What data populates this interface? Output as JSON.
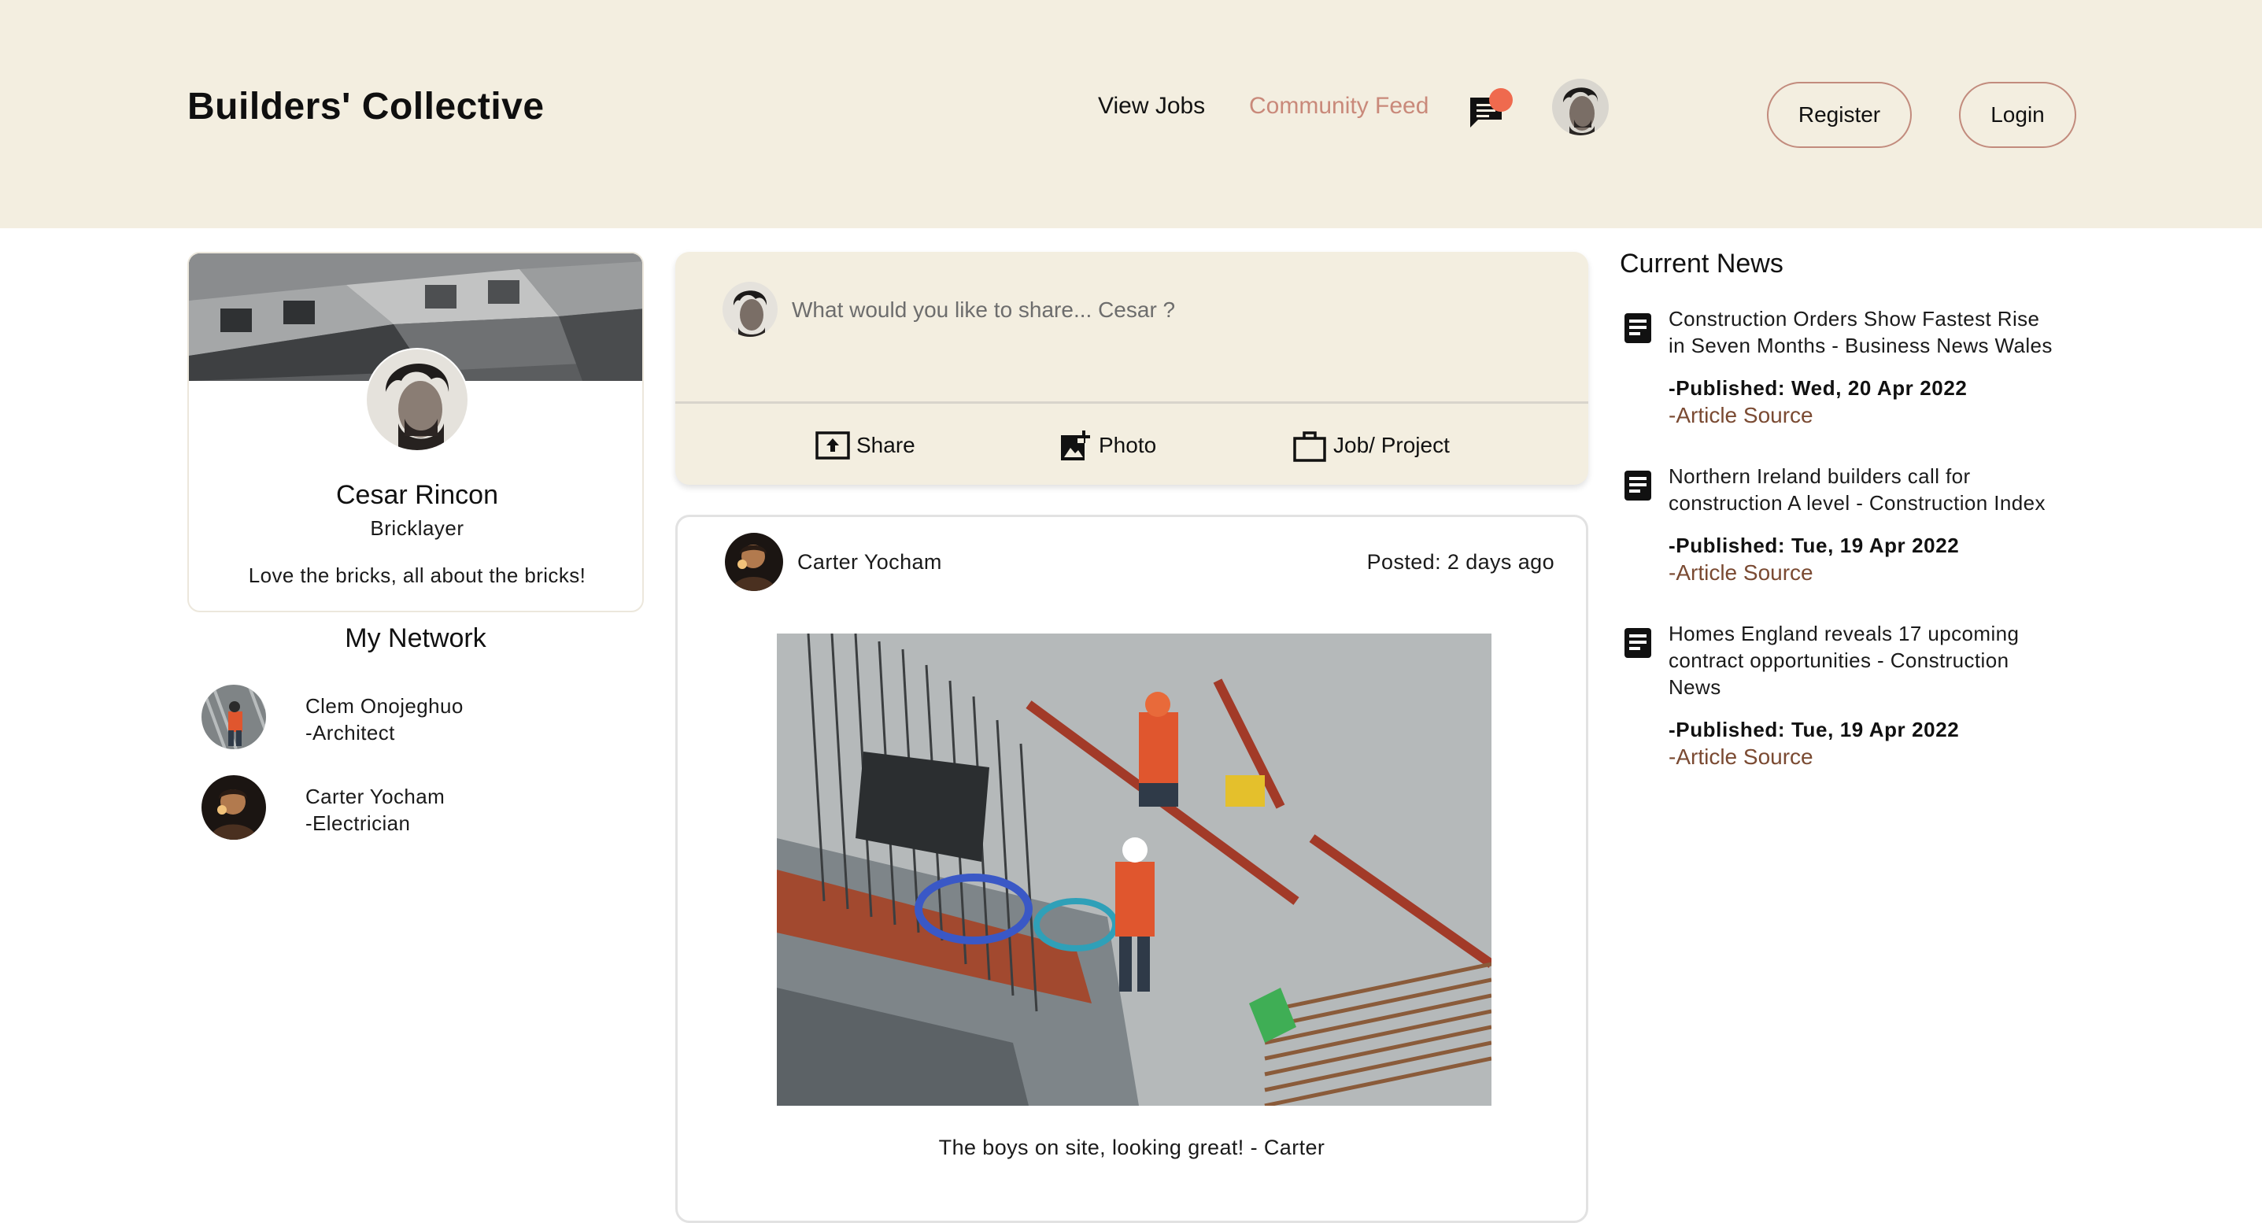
{
  "header": {
    "brand": "Builders' Collective",
    "nav": {
      "view_jobs": "View Jobs",
      "community_feed": "Community Feed"
    },
    "register_label": "Register",
    "login_label": "Login"
  },
  "profile": {
    "name": "Cesar Rincon",
    "role": "Bricklayer",
    "bio": "Love the bricks, all about the bricks!"
  },
  "network": {
    "title": "My Network",
    "people": [
      {
        "name": "Clem Onojeghuo",
        "role": "-Architect"
      },
      {
        "name": "Carter Yocham",
        "role": "-Electrician"
      }
    ]
  },
  "composer": {
    "placeholder": "What would you like to share... Cesar ?",
    "actions": {
      "share": "Share",
      "photo": "Photo",
      "job": "Job/ Project"
    }
  },
  "post": {
    "author": "Carter Yocham",
    "time": "Posted: 2 days ago",
    "caption": "The boys on site, looking great! - Carter"
  },
  "news": {
    "title": "Current News",
    "items": [
      {
        "headline_line1": "Construction Orders Show Fastest Rise",
        "headline_line2": "in Seven Months - Business News Wales",
        "headline_line3": "",
        "date": "-Published: Wed, 20 Apr 2022",
        "source": "-Article Source"
      },
      {
        "headline_line1": "Northern Ireland builders call for",
        "headline_line2": "construction A level - Construction Index",
        "headline_line3": "",
        "date": "-Published: Tue, 19 Apr 2022",
        "source": "-Article Source"
      },
      {
        "headline_line1": "Homes England reveals 17 upcoming",
        "headline_line2": "contract opportunities - Construction",
        "headline_line3": "News",
        "date": "-Published: Tue, 19 Apr 2022",
        "source": "-Article Source"
      }
    ]
  },
  "colors": {
    "header_bg": "#f3eee0",
    "accent": "#c9897a",
    "notification_dot": "#ef6a4e",
    "source_link": "#7a4a32"
  },
  "icons": {
    "messages": "chat-bubble-icon",
    "share": "upload-box-icon",
    "photo": "add-photo-icon",
    "job": "briefcase-icon",
    "news": "article-icon"
  }
}
